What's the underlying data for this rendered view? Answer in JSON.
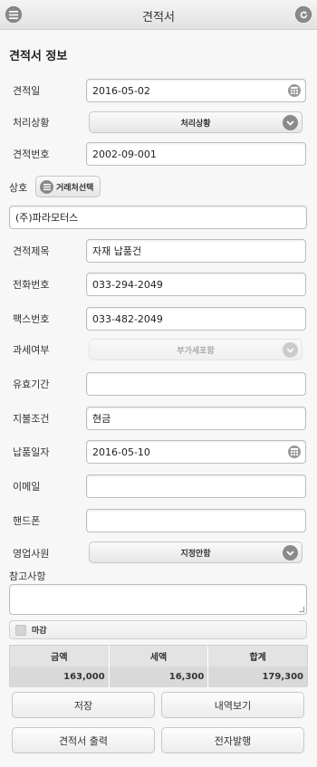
{
  "header": {
    "title": "견적서",
    "menu_icon": "list-icon",
    "back_icon": "refresh-back-icon"
  },
  "section": {
    "title": "견적서 정보"
  },
  "form": {
    "quote_date": {
      "label": "견적일",
      "value": "2016-05-02"
    },
    "status": {
      "label": "처리상황",
      "value": "처리상황"
    },
    "quote_no": {
      "label": "견적번호",
      "value": "2002-09-001"
    },
    "company": {
      "label": "상호",
      "button": "거래처선택",
      "value": "(주)파라모터스"
    },
    "subject": {
      "label": "견적제목",
      "value": "자재 납품건"
    },
    "phone": {
      "label": "전화번호",
      "value": "033-294-2049"
    },
    "fax": {
      "label": "팩스번호",
      "value": "033-482-2049"
    },
    "tax": {
      "label": "과세여부",
      "value": "부가세포함"
    },
    "validity": {
      "label": "유효기간",
      "value": ""
    },
    "payment": {
      "label": "지불조건",
      "value": "현금"
    },
    "delivery_date": {
      "label": "납품일자",
      "value": "2016-05-10"
    },
    "email": {
      "label": "이메일",
      "value": ""
    },
    "mobile": {
      "label": "핸드폰",
      "value": ""
    },
    "sales_rep": {
      "label": "영업사원",
      "value": "지정안함"
    },
    "notes": {
      "label": "참고사항",
      "value": ""
    },
    "closed": {
      "label": "마감",
      "checked": false
    }
  },
  "totals": {
    "headers": [
      "금액",
      "세액",
      "합계"
    ],
    "values": [
      "163,000",
      "16,300",
      "179,300"
    ]
  },
  "buttons": {
    "save": "저장",
    "details": "내역보기",
    "print": "견적서 출력",
    "e_issue": "전자발행"
  }
}
